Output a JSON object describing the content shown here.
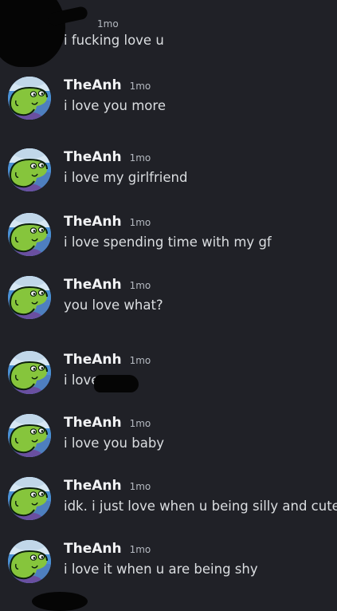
{
  "first_message": {
    "time": "1mo",
    "text": "i fucking love u"
  },
  "messages": [
    {
      "author": "TheAnh",
      "time": "1mo",
      "text": "i love you more"
    },
    {
      "author": "TheAnh",
      "time": "1mo",
      "text": "i love my girlfriend"
    },
    {
      "author": "TheAnh",
      "time": "1mo",
      "text": "i love spending time with my gf"
    },
    {
      "author": "TheAnh",
      "time": "1mo",
      "text": "you love what?"
    },
    {
      "author": "TheAnh",
      "time": "1mo",
      "text": "i love u"
    },
    {
      "author": "TheAnh",
      "time": "1mo",
      "text": "i love you baby"
    },
    {
      "author": "TheAnh",
      "time": "1mo",
      "text": "idk. i just love when u being silly and cute"
    },
    {
      "author": "TheAnh",
      "time": "1mo",
      "text": "i love it when u are being shy"
    }
  ],
  "avatar_icon": "green-frog-character",
  "colors": {
    "background": "#202127",
    "author": "#f2f3f5",
    "message_text": "#dbdee1",
    "timestamp": "#b5bac1"
  }
}
